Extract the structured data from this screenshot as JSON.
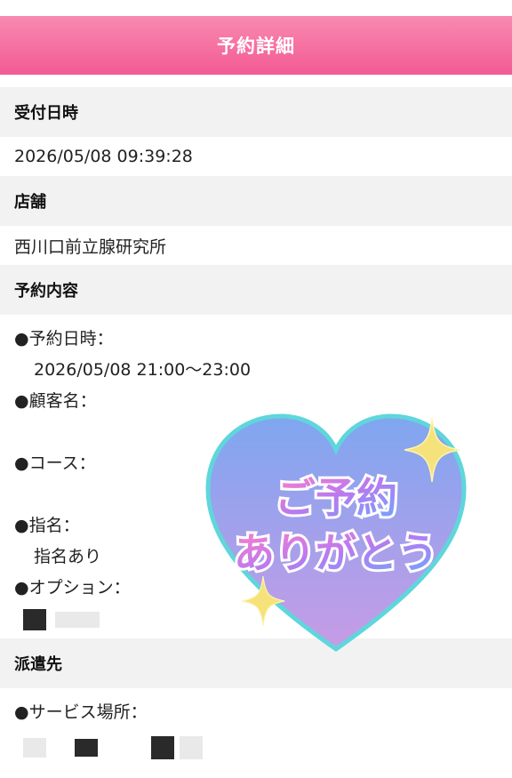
{
  "header": {
    "title": "予約詳細"
  },
  "received": {
    "label": "受付日時",
    "value": "2026/05/08 09:39:28"
  },
  "store": {
    "label": "店舗",
    "value": "西川口前立腺研究所"
  },
  "reservation": {
    "label": "予約内容",
    "date_label": "●予約日時：",
    "date_value": "2026/05/08 21:00～23:00",
    "customer_label": "●顧客名：",
    "course_label": "●コース：",
    "nomination_label": "●指名：",
    "nomination_value": "指名あり",
    "option_label": "●オプション："
  },
  "dispatch": {
    "label": "派遣先",
    "place_label": "●サービス場所："
  },
  "sticker": {
    "line1": "ご予約",
    "line2": "ありがとう",
    "icon": "heart-icon"
  },
  "colors": {
    "header_pink": "#f25a93",
    "heart_top": "#7fa6f0",
    "heart_bottom": "#c79be6",
    "heart_outline": "#5fd6dc",
    "sparkle": "#f5e27a"
  }
}
